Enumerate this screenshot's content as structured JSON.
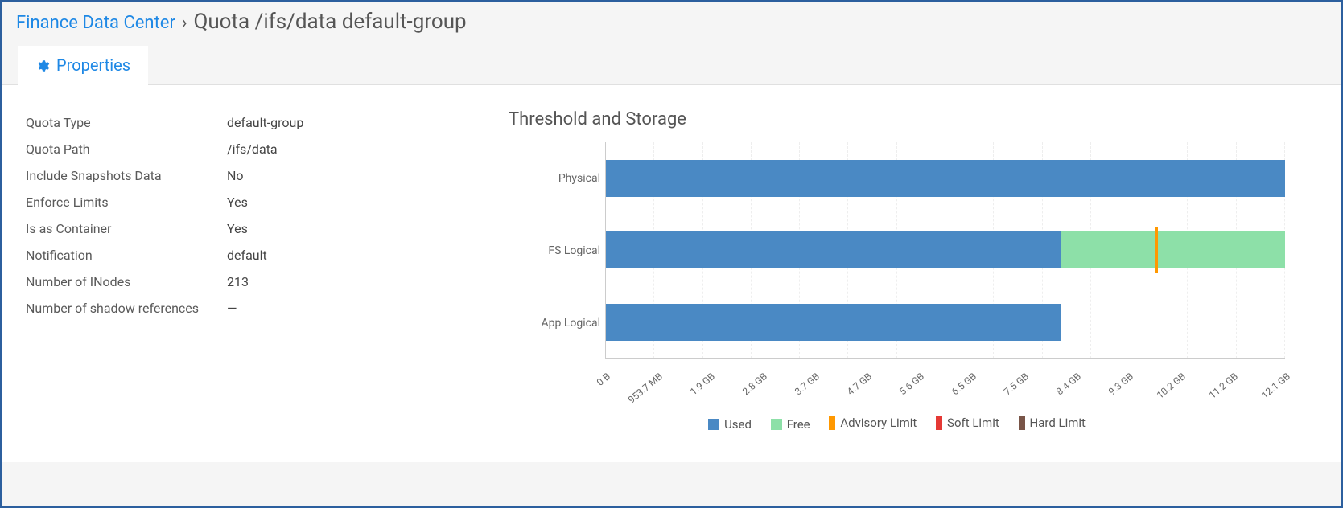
{
  "breadcrumb": {
    "parent": "Finance Data Center",
    "separator": "›",
    "title": "Quota /ifs/data default-group"
  },
  "tab": {
    "label": "Properties"
  },
  "properties": [
    {
      "label": "Quota Type",
      "value": "default-group"
    },
    {
      "label": "Quota Path",
      "value": "/ifs/data"
    },
    {
      "label": "Include Snapshots Data",
      "value": "No"
    },
    {
      "label": "Enforce Limits",
      "value": "Yes"
    },
    {
      "label": "Is as Container",
      "value": "Yes"
    },
    {
      "label": "Notification",
      "value": "default"
    },
    {
      "label": "Number of INodes",
      "value": "213"
    },
    {
      "label": "Number of shadow references",
      "value": "—"
    }
  ],
  "chart_title": "Threshold and Storage",
  "chart_data": {
    "type": "bar",
    "orientation": "horizontal",
    "categories": [
      "Physical",
      "FS Logical",
      "App Logical"
    ],
    "x_unit": "GB",
    "x_max": 13.0,
    "series": [
      {
        "name": "Used",
        "color": "#4a89c4",
        "values": [
          13.0,
          8.7,
          8.7
        ]
      },
      {
        "name": "Free",
        "color": "#8de0a8",
        "values": [
          0,
          4.3,
          0
        ]
      }
    ],
    "markers": [
      {
        "name": "Advisory Limit",
        "color": "#ff9800",
        "category": "FS Logical",
        "value": 10.5
      },
      {
        "name": "Soft Limit",
        "color": "#e53935",
        "category": null,
        "value": null
      },
      {
        "name": "Hard Limit",
        "color": "#795548",
        "category": null,
        "value": null
      }
    ],
    "x_ticks": [
      "0 B",
      "953.7 MB",
      "1.9 GB",
      "2.8 GB",
      "3.7 GB",
      "4.7 GB",
      "5.6 GB",
      "6.5 GB",
      "7.5 GB",
      "8.4 GB",
      "9.3 GB",
      "10.2 GB",
      "11.2 GB",
      "12.1 GB"
    ],
    "title": "Threshold and Storage",
    "xlabel": "",
    "ylabel": ""
  },
  "legend": {
    "used": "Used",
    "free": "Free",
    "advisory": "Advisory Limit",
    "soft": "Soft Limit",
    "hard": "Hard Limit"
  },
  "colors": {
    "used": "#4a89c4",
    "free": "#8de0a8",
    "advisory": "#ff9800",
    "soft": "#e53935",
    "hard": "#795548"
  }
}
